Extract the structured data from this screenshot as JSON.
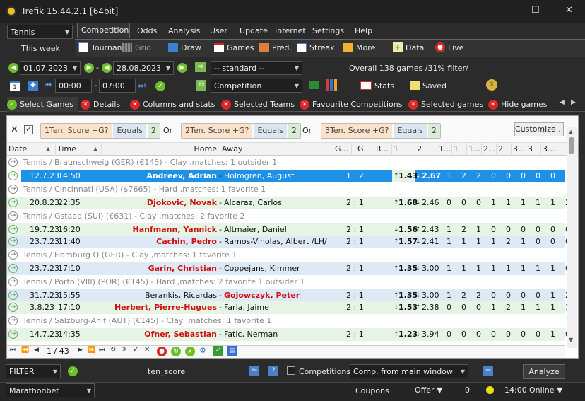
{
  "window": {
    "title": "Trefik 15.44.2.1 [64bit]",
    "min": "—",
    "max": "☐",
    "close": "✕"
  },
  "sport": "Tennis",
  "menu": [
    "Competition",
    "Odds",
    "Analysis",
    "User",
    "Update",
    "Internet",
    "Settings",
    "Help"
  ],
  "this_week": "This week",
  "toolbar": {
    "tournam": "Tournam",
    "grid": "Grid",
    "draw": "Draw",
    "games": "Games",
    "pred": "Pred.",
    "streak": "Streak",
    "more": "More",
    "data": "Data",
    "live": "Live"
  },
  "dates": {
    "from": "01.07.2023",
    "to": "28.08.2023",
    "standard": "-- standard --",
    "overall": "Overall 138 games /31% filter/"
  },
  "times": {
    "from": "00:00",
    "to": "07:00",
    "dash": "-",
    "dash2": "-",
    "competition": "Competition",
    "stats": "Stats",
    "saved": "Saved"
  },
  "tabs": [
    "Select Games",
    "Details",
    "Columns and stats",
    "Selected Teams",
    "Favourite Competitions",
    "Selected games",
    "Hide games"
  ],
  "filters": {
    "f1": {
      "a": "1Ten. Score +G?",
      "b": "Equals",
      "c": "2"
    },
    "or1": "Or",
    "f2": {
      "a": "2Ten. Score +G?",
      "b": "Equals",
      "c": "2"
    },
    "or2": "Or",
    "f3": {
      "a": "3Ten. Score +G?",
      "b": "Equals",
      "c": "2"
    },
    "customize": "Customize..."
  },
  "columns": [
    "Date",
    "Time",
    "Home",
    "Away",
    "G...",
    "G...",
    "R...",
    "1",
    "2",
    "1...",
    "1",
    "1...",
    "2...",
    "2",
    "3...",
    "3",
    "3..."
  ],
  "rows": [
    {
      "type": "grp",
      "text": "Tennis / Braunschweig (GER)   (€145) - Clay ,matches: 1           outsider 1"
    },
    {
      "type": "sel",
      "date": "12.7.23",
      "time": "14:50",
      "home": "Andreev, Adrian",
      "away": "Holmgren, August",
      "score": "1 : 2",
      "o1": "1.43",
      "o2": "2.67",
      "a1": "↑",
      "a2": "↓",
      "n": [
        "1",
        "2",
        "2",
        "0",
        "0",
        "0",
        "0",
        "0",
        "0",
        "0"
      ]
    },
    {
      "type": "grp",
      "text": "Tennis / Cincinnati (USA)   ($7665) - Hard ,matches: 1           favorite 1"
    },
    {
      "type": "odd",
      "date": "20.8.23",
      "time": "22:35",
      "home": "Djokovic, Novak",
      "away": "Alcaraz, Carlos",
      "score": "2 : 1",
      "o1": "1.68",
      "o2": "2.46",
      "a1": "↑",
      "a2": "↓",
      "n": [
        "0",
        "0",
        "0",
        "1",
        "1",
        "1",
        "1",
        "1",
        "2",
        "1"
      ]
    },
    {
      "type": "grp",
      "text": "Tennis / Gstaad (SUI)   (€631) - Clay ,matches: 2           favorite 2"
    },
    {
      "type": "odd",
      "date": "19.7.23",
      "time": "16:20",
      "home": "Hanfmann, Yannick",
      "away": "Altmaier, Daniel",
      "score": "2 : 1",
      "o1": "1.56",
      "o2": "2.43",
      "a1": "↓",
      "a2": "↑",
      "n": [
        "1",
        "2",
        "1",
        "0",
        "0",
        "0",
        "0",
        "0",
        "0",
        "0"
      ]
    },
    {
      "type": "even",
      "date": "23.7.23",
      "time": "11:40",
      "home": "Cachin, Pedro",
      "away": "Ramos-Vinolas, Albert /LH/",
      "score": "2 : 1",
      "o1": "1.57",
      "o2": "2.41",
      "a1": "↑",
      "a2": "↓",
      "n": [
        "1",
        "1",
        "1",
        "1",
        "2",
        "1",
        "0",
        "0",
        "0",
        "0"
      ]
    },
    {
      "type": "grp",
      "text": "Tennis / Hamburg Q (GER)   - Clay ,matches: 1           favorite 1"
    },
    {
      "type": "even",
      "date": "23.7.23",
      "time": "17:10",
      "home": "Garin, Christian",
      "away": "Coppejans, Kimmer",
      "score": "2 : 1",
      "o1": "1.35",
      "o2": "3.00",
      "a1": "↑",
      "a2": "↓",
      "n": [
        "1",
        "1",
        "1",
        "1",
        "1",
        "1",
        "1",
        "1",
        "0",
        "0"
      ]
    },
    {
      "type": "grp",
      "text": "Tennis / Porto (VIII) (POR)   (€145) - Hard ,matches: 2           favorite 1   outsider 1"
    },
    {
      "type": "even",
      "date": "31.7.23",
      "time": "15:55",
      "home": "Berankis, Ricardas",
      "away": "Gojowczyk, Peter",
      "score": "2 : 1",
      "o1": "1.35",
      "o2": "3.00",
      "a1": "↑",
      "a2": "↓",
      "n": [
        "1",
        "2",
        "2",
        "0",
        "0",
        "0",
        "0",
        "1",
        "2",
        "2"
      ],
      "awayred": true,
      "homeplain": true
    },
    {
      "type": "odd",
      "date": "3.8.23",
      "time": "17:10",
      "home": "Herbert, Pierre-Hugues",
      "away": "Faria, Jaime",
      "score": "2 : 1",
      "o1": "1.53",
      "o2": "2.38",
      "a1": "↓",
      "a2": "↑",
      "n": [
        "0",
        "0",
        "0",
        "1",
        "2",
        "1",
        "1",
        "1",
        "1",
        "1"
      ]
    },
    {
      "type": "grp",
      "text": "Tennis / Salzburg-Anif (AUT)   (€145) - Clay ,matches: 1           favorite 1"
    },
    {
      "type": "odd",
      "date": "14.7.23",
      "time": "14:35",
      "home": "Ofner, Sebastian",
      "away": "Fatic, Nerman",
      "score": "2 : 1",
      "o1": "1.23",
      "o2": "3.94",
      "a1": "↑",
      "a2": "↓",
      "n": [
        "0",
        "0",
        "0",
        "0",
        "0",
        "0",
        "0",
        "1",
        "0",
        "0"
      ]
    }
  ],
  "pager": "1 / 43",
  "bottom": {
    "filter": "FILTER",
    "score_name": "ten_score",
    "competitions": "Competitions:",
    "comp_src": "Comp. from main window",
    "analyze": "Analyze"
  },
  "status": {
    "bookmaker": "Marathonbet",
    "coupons": "Coupons",
    "offer": "Offer ▼",
    "count": "0",
    "time": "14:00",
    "online": "Online ▼"
  },
  "colors": {
    "selection": "#1e90e6",
    "home_red": "#d01010",
    "odd_row": "#e6f4e6",
    "even_row": "#ddeaf5"
  }
}
